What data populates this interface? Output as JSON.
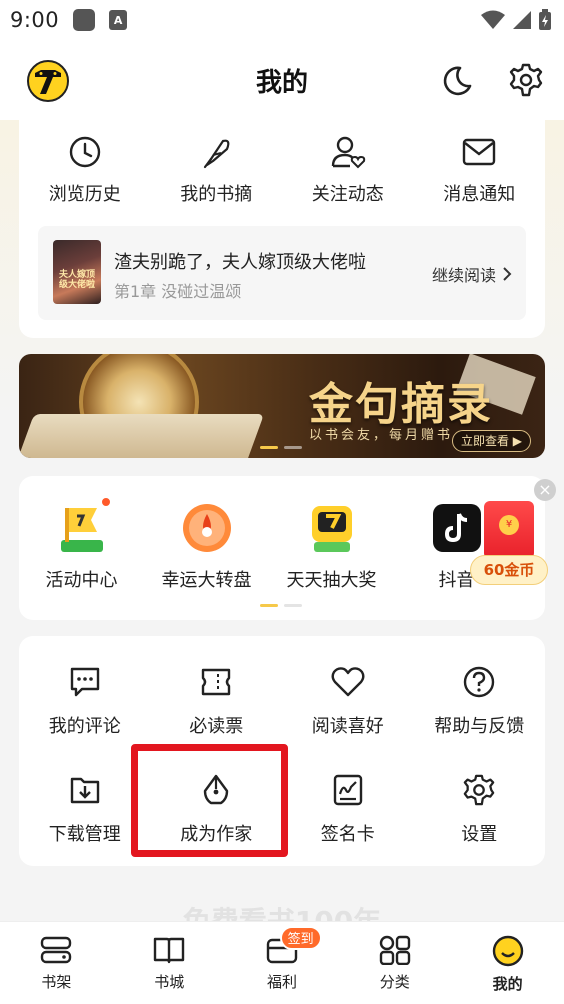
{
  "status_bar": {
    "time": "9:00",
    "notif_icon_letter": "A"
  },
  "header": {
    "title": "我的"
  },
  "quick_links": [
    {
      "label": "浏览历史",
      "icon": "clock-icon"
    },
    {
      "label": "我的书摘",
      "icon": "feather-icon"
    },
    {
      "label": "关注动态",
      "icon": "user-heart-icon"
    },
    {
      "label": "消息通知",
      "icon": "mail-icon"
    }
  ],
  "continue_reading": {
    "cover_text": "夫人嫁顶级大佬啦",
    "book_title": "渣夫别跪了，夫人嫁顶级大佬啦",
    "chapter": "第1章  没碰过温颂",
    "action": "继续阅读"
  },
  "banner": {
    "title": "金句摘录",
    "subtitle": "以书会友，每月赠书",
    "button": "立即查看"
  },
  "activities": [
    {
      "label": "活动中心",
      "icon": "flag-icon",
      "dot": true
    },
    {
      "label": "幸运大转盘",
      "icon": "wheel-icon",
      "dot": false
    },
    {
      "label": "天天抽大奖",
      "icon": "slot-machine-icon",
      "dot": false
    },
    {
      "label": "抖音",
      "icon": "tiktok-icon",
      "dot": false
    }
  ],
  "red_packet": {
    "coins": "60金币",
    "seal": "¥"
  },
  "tools": [
    {
      "label": "我的评论",
      "icon": "comment-icon"
    },
    {
      "label": "必读票",
      "icon": "ticket-icon"
    },
    {
      "label": "阅读喜好",
      "icon": "heart-icon"
    },
    {
      "label": "帮助与反馈",
      "icon": "help-icon"
    },
    {
      "label": "下载管理",
      "icon": "download-icon"
    },
    {
      "label": "成为作家",
      "icon": "pen-nib-icon"
    },
    {
      "label": "签名卡",
      "icon": "signature-icon"
    },
    {
      "label": "设置",
      "icon": "gear-icon"
    }
  ],
  "faded_footer": "免费看书100年",
  "bottom_nav": [
    {
      "label": "书架",
      "icon": "shelf-icon"
    },
    {
      "label": "书城",
      "icon": "book-open-icon"
    },
    {
      "label": "福利",
      "icon": "gift-icon",
      "badge": "签到"
    },
    {
      "label": "分类",
      "icon": "grid-icon"
    },
    {
      "label": "我的",
      "icon": "smiley-icon",
      "active": true
    }
  ],
  "colors": {
    "accent_yellow": "#ffd21f",
    "highlight_red": "#e3161f",
    "badge_orange": "#ff6a2a"
  }
}
